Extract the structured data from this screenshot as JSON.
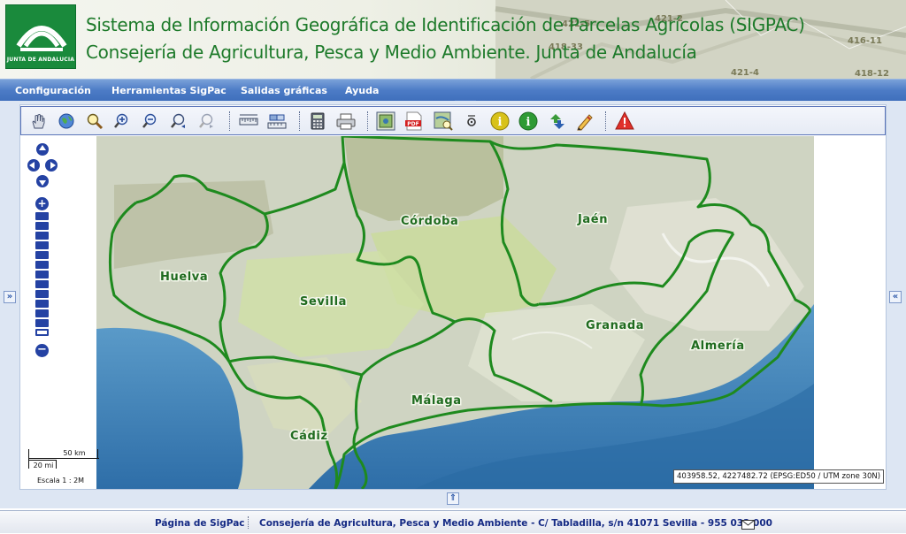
{
  "header": {
    "logo_text": "JUNTA DE ANDALUCIA",
    "title_line1": "Sistema de Información Geográfica de Identificación de Parcelas Agrícolas (SIGPAC)",
    "title_line2": "Consejería de Agricultura, Pesca y Medio Ambiente. Junta de Andalucía",
    "background_parcel_labels": [
      "421-5",
      "421-2",
      "418-33",
      "416-11",
      "421-4",
      "418-12"
    ]
  },
  "menu": {
    "items": [
      {
        "label": "Configuración"
      },
      {
        "label": "Herramientas SigPac"
      },
      {
        "label": "Salidas gráficas"
      },
      {
        "label": "Ayuda"
      }
    ]
  },
  "toolbar": {
    "buttons": [
      {
        "icon": "hand-pan-icon"
      },
      {
        "icon": "globe-icon"
      },
      {
        "icon": "search-icon"
      },
      {
        "icon": "zoom-in-icon"
      },
      {
        "icon": "zoom-out-icon"
      },
      {
        "icon": "zoom-previous-icon"
      },
      {
        "icon": "zoom-next-icon"
      },
      {
        "icon": "measure-distance-icon"
      },
      {
        "icon": "measure-area-icon"
      },
      {
        "icon": "calculator-icon"
      },
      {
        "icon": "print-icon"
      },
      {
        "icon": "map-image-icon"
      },
      {
        "icon": "pdf-icon"
      },
      {
        "icon": "identify-map-icon"
      },
      {
        "icon": "coordinates-icon"
      },
      {
        "icon": "info-yellow-icon"
      },
      {
        "icon": "info-green-icon"
      },
      {
        "icon": "sync-arrows-icon"
      },
      {
        "icon": "pencil-icon"
      },
      {
        "icon": "warning-icon"
      }
    ]
  },
  "map": {
    "provinces": [
      {
        "name": "Huelva"
      },
      {
        "name": "Sevilla"
      },
      {
        "name": "Córdoba"
      },
      {
        "name": "Jaén"
      },
      {
        "name": "Granada"
      },
      {
        "name": "Almería"
      },
      {
        "name": "Málaga"
      },
      {
        "name": "Cádiz"
      }
    ],
    "colors": {
      "boundary": "#1e8a1e",
      "sea": "#3a78b0",
      "land": "#d9dcc9",
      "label": "#1f6b1f"
    }
  },
  "scale": {
    "km_label": "50 km",
    "mi_label": "20 mi",
    "ratio_label": "Escala 1 : 2M"
  },
  "coordinates": {
    "text": "403958.52, 4227482.72 (EPSG:ED50 / UTM zone 30N)"
  },
  "toggles": {
    "left": "»",
    "right": "«",
    "bottom": "⇑"
  },
  "footer": {
    "link1": "Página de SigPac",
    "link2": "Consejería de Agricultura, Pesca y Medio Ambiente - C/ Tabladilla, s/n 41071 Sevilla - 955 032 000",
    "mail_icon": "mail-icon"
  }
}
